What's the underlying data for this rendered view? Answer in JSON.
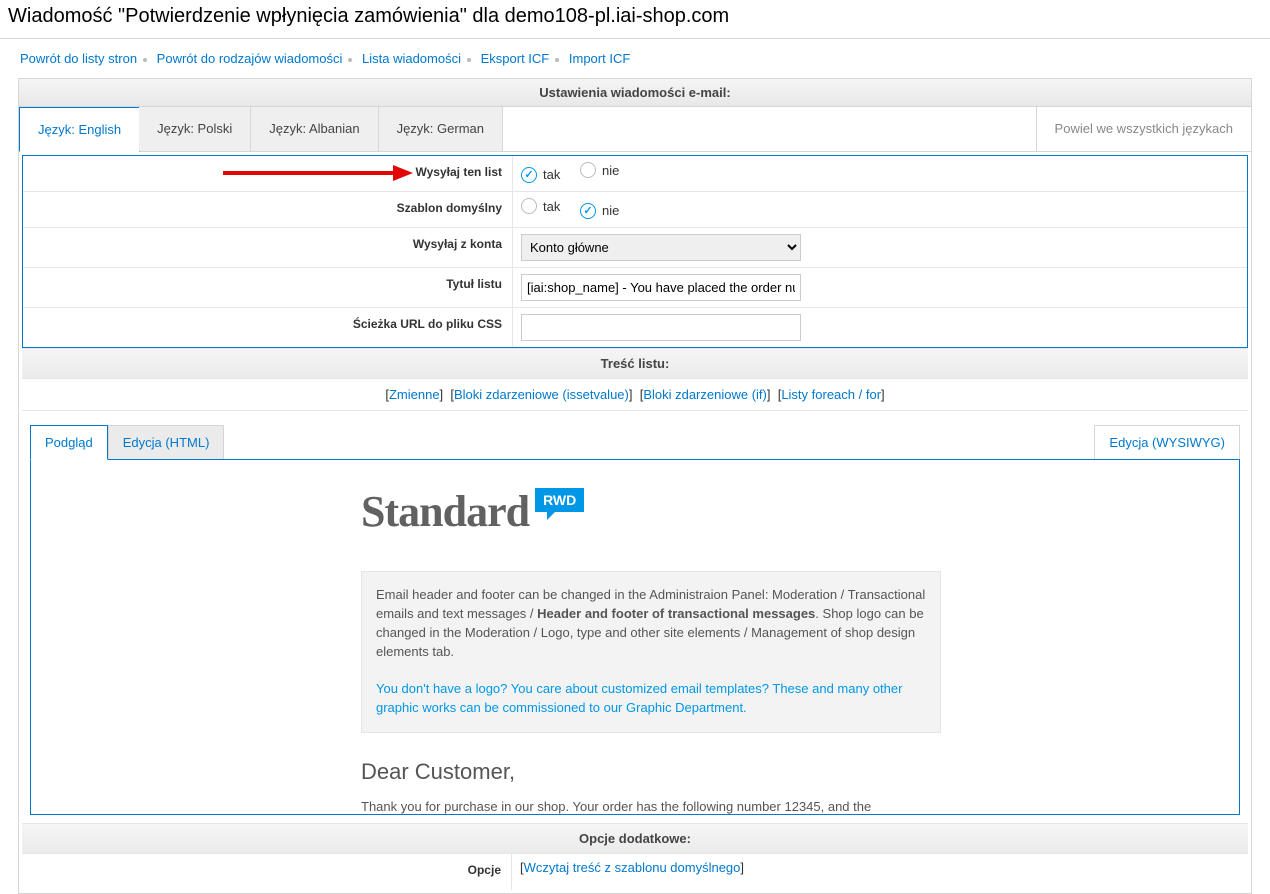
{
  "header": {
    "title": "Wiadomość \"Potwierdzenie wpłynięcia zamówienia\" dla demo108-pl.iai-shop.com"
  },
  "breadcrumbs": [
    "Powrót do listy stron",
    "Powrót do rodzajów wiadomości",
    "Lista wiadomości",
    "Eksport ICF",
    "Import ICF"
  ],
  "panel_header": "Ustawienia wiadomości e-mail:",
  "lang_tabs": [
    "Język: English",
    "Język: Polski",
    "Język: Albanian",
    "Język: German"
  ],
  "clone_all": "Powiel we wszystkich językach",
  "form": {
    "send_label": "Wysyłaj ten list",
    "send_yes": "tak",
    "send_no": "nie",
    "default_label": "Szablon domyślny",
    "default_yes": "tak",
    "default_no": "nie",
    "account_label": "Wysyłaj z konta",
    "account_value": "Konto główne",
    "title_label": "Tytuł listu",
    "title_value": "[iai:shop_name] - You have placed the order numb",
    "css_label": "Ścieżka URL do pliku CSS",
    "css_value": ""
  },
  "body_header": "Treść listu:",
  "help_links": [
    "Zmienne",
    "Bloki zdarzeniowe (issetvalue)",
    "Bloki zdarzeniowe (if)",
    "Listy foreach / for"
  ],
  "editor_tabs": {
    "preview": "Podgląd",
    "html": "Edycja (HTML)",
    "wys": "Edycja (WYSIWYG)"
  },
  "preview": {
    "logo_word": "Standard",
    "rwd": "RWD",
    "note_a": "Email header and footer can be changed in the Administraion Panel: Moderation / Transactional emails and text messages / ",
    "note_b": "Header and footer of transactional messages",
    "note_c": ". Shop logo can be changed in the Moderation / Logo, type and other site elements / Management of shop design elements tab.",
    "note_link": "You don't have a logo? You care about customized email templates? These and many other graphic works can be commissioned to our Graphic Department.",
    "greeting": "Dear Customer,",
    "body": "Thank you for purchase in our shop. Your order has the following number 12345, and the"
  },
  "extra": {
    "header": "Opcje dodatkowe:",
    "opt_label": "Opcje",
    "opt_link": "Wczytaj treść z szablonu domyślnego"
  }
}
